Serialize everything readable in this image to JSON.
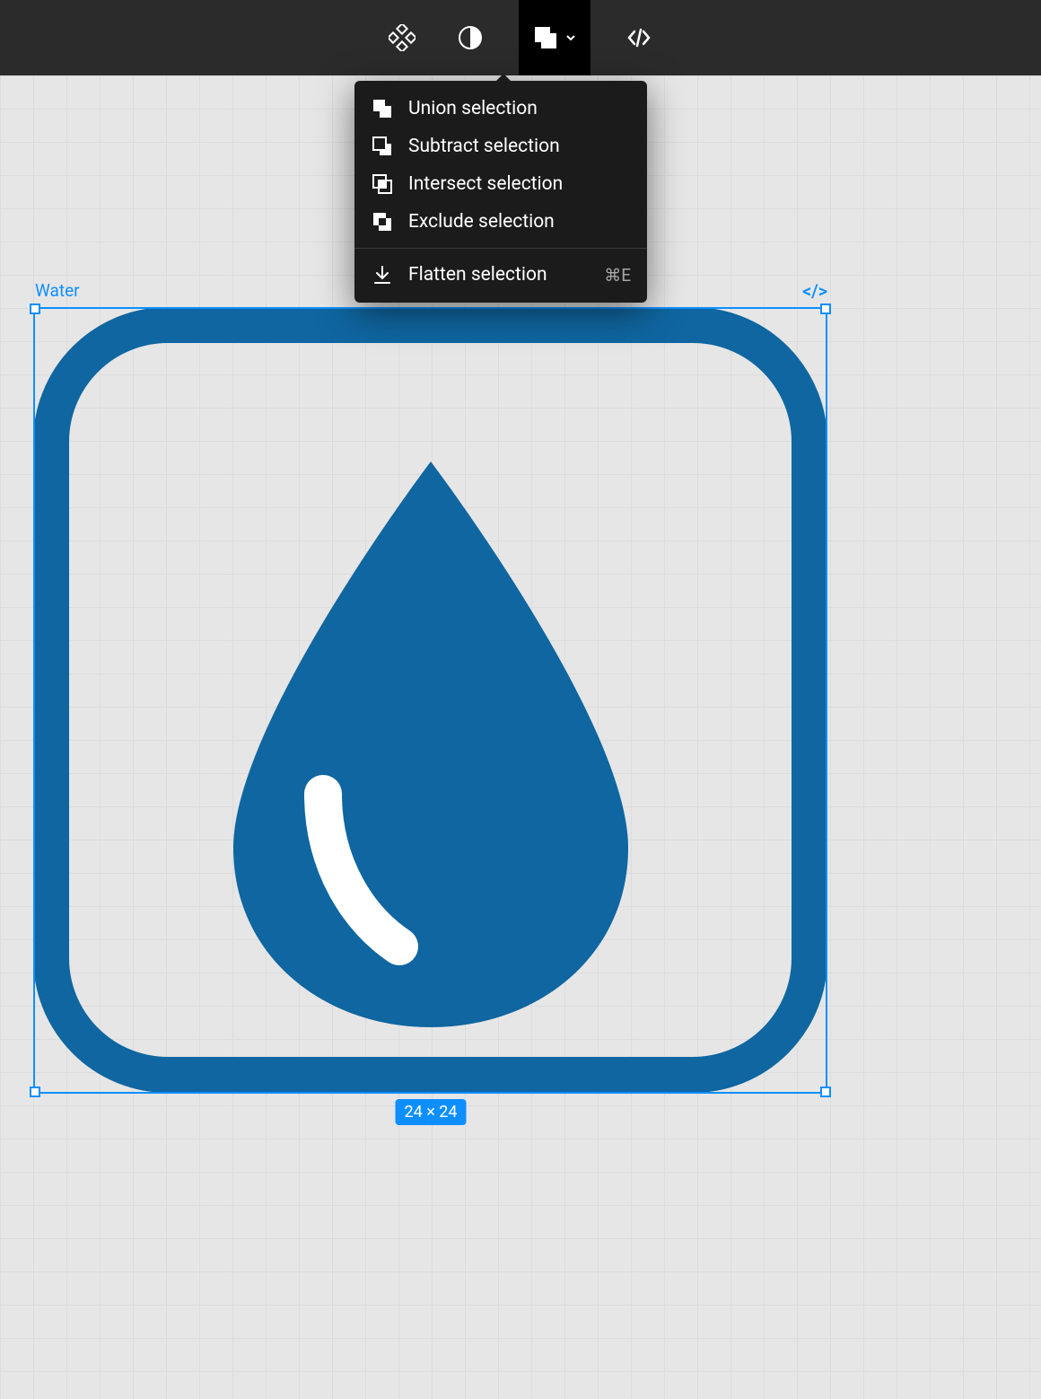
{
  "toolbar": {
    "tools": {
      "components": "components-icon",
      "mask": "mask-icon",
      "boolean": "boolean-icon",
      "code": "code-icon"
    }
  },
  "dropdown": {
    "items": [
      {
        "icon": "union-icon",
        "label": "Union selection",
        "shortcut": ""
      },
      {
        "icon": "subtract-icon",
        "label": "Subtract selection",
        "shortcut": ""
      },
      {
        "icon": "intersect-icon",
        "label": "Intersect selection",
        "shortcut": ""
      },
      {
        "icon": "exclude-icon",
        "label": "Exclude selection",
        "shortcut": ""
      }
    ],
    "flatten": {
      "icon": "flatten-icon",
      "label": "Flatten selection",
      "shortcut": "⌘E"
    }
  },
  "selection": {
    "label": "Water",
    "code_badge": "</>",
    "dimensions": "24 × 24"
  },
  "colors": {
    "shape": "#0f66a0",
    "accent": "#0e8fff"
  }
}
